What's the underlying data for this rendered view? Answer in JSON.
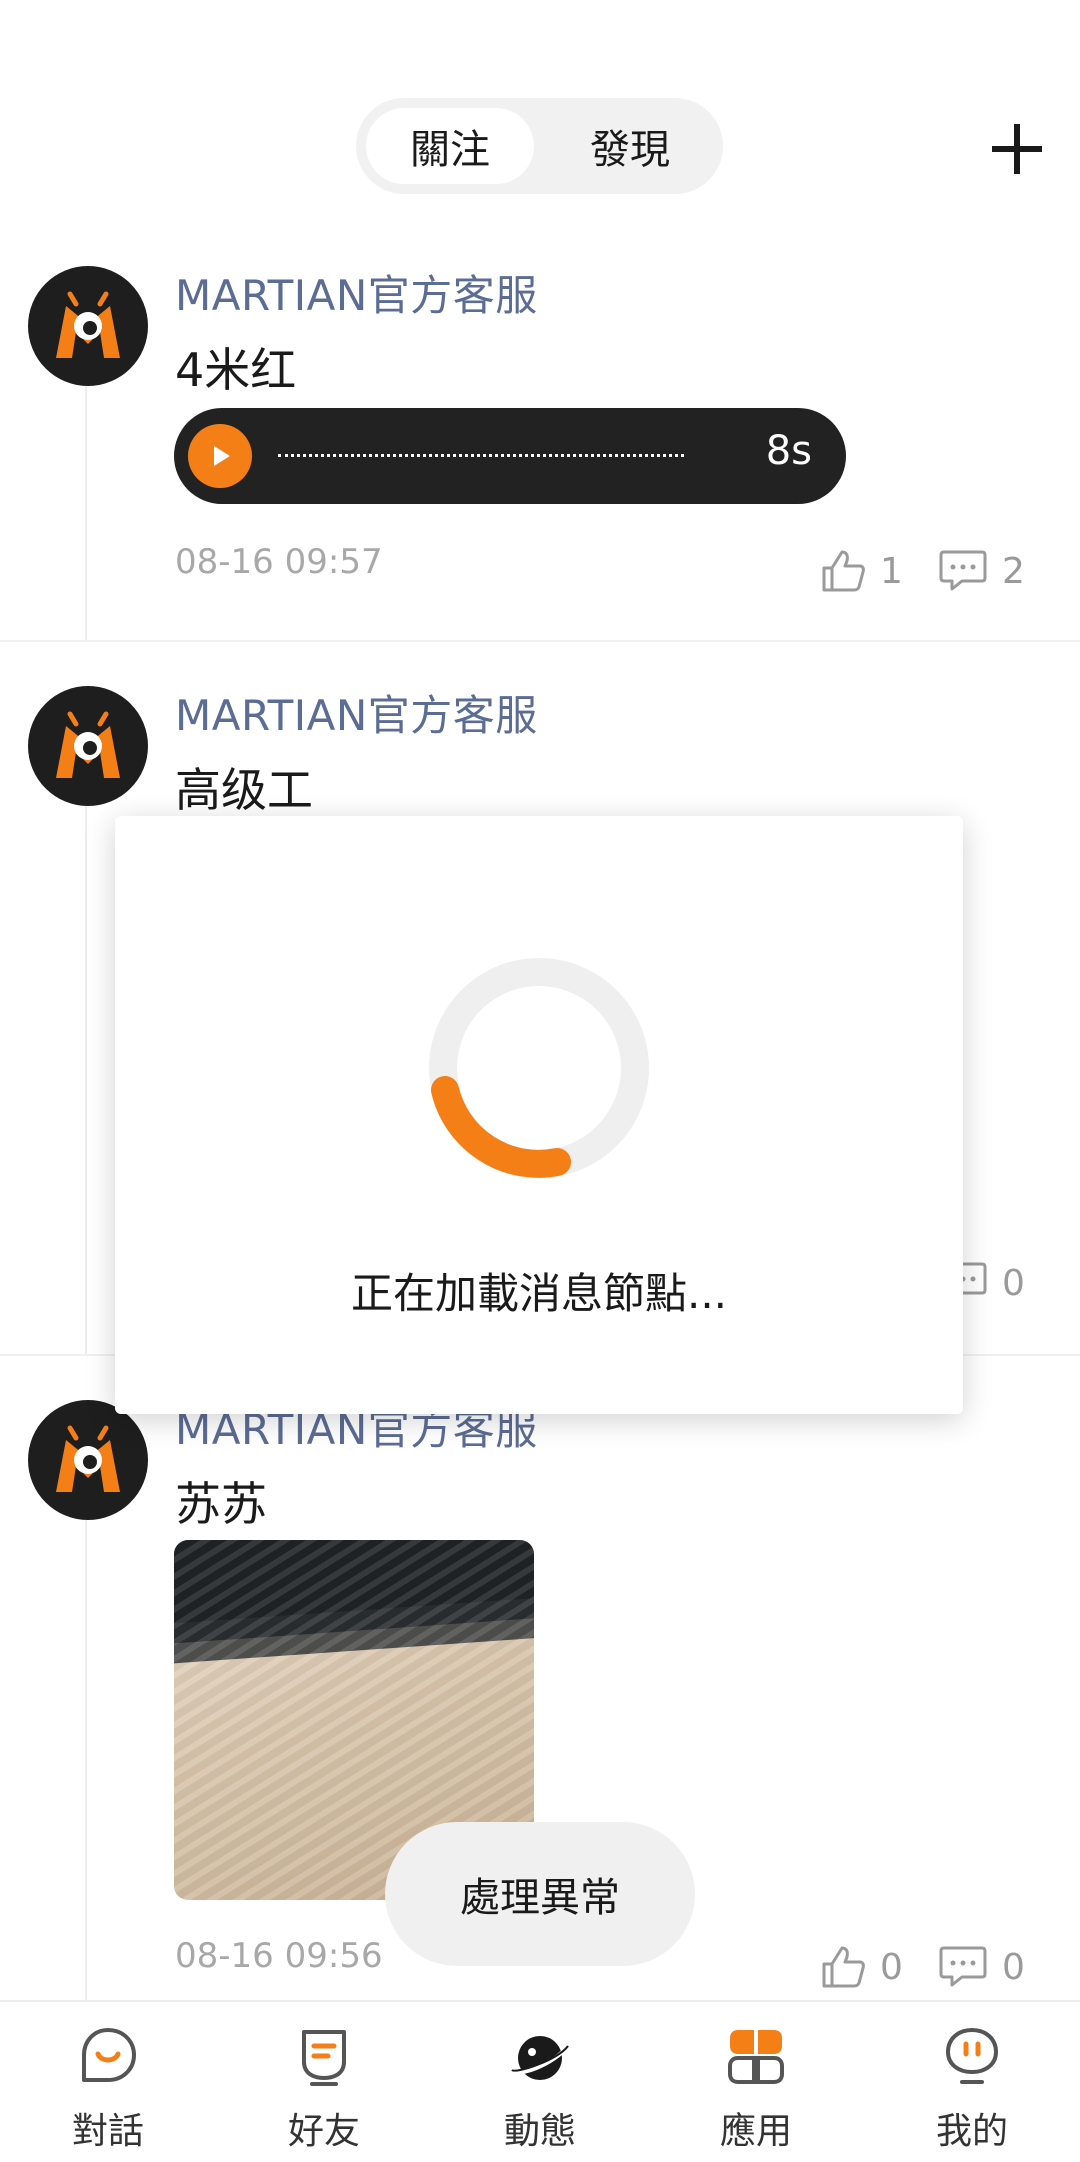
{
  "header": {
    "tabs": [
      {
        "label": "關注",
        "active": true
      },
      {
        "label": "發現",
        "active": false
      }
    ],
    "add_icon": "plus-icon"
  },
  "feed": [
    {
      "author": "MARTIAN官方客服",
      "text": "4米红",
      "voice": {
        "duration": "8s"
      },
      "time": "08-16 09:57",
      "likes": "1",
      "comments": "2"
    },
    {
      "author": "MARTIAN官方客服",
      "text": "高级工",
      "comments": "0"
    },
    {
      "author": "MARTIAN官方客服",
      "text": "苏苏",
      "time": "08-16 09:56",
      "likes": "0",
      "comments": "0"
    }
  ],
  "loading_dialog": {
    "message": "正在加載消息節點..."
  },
  "toast": {
    "message": "處理異常"
  },
  "bottom_nav": [
    {
      "label": "對話",
      "icon": "chat-bubble-icon"
    },
    {
      "label": "好友",
      "icon": "friends-icon"
    },
    {
      "label": "動態",
      "icon": "planet-icon",
      "active": true
    },
    {
      "label": "應用",
      "icon": "apps-icon"
    },
    {
      "label": "我的",
      "icon": "profile-icon"
    }
  ],
  "colors": {
    "accent": "#f57f17",
    "author": "#5b6c95"
  }
}
